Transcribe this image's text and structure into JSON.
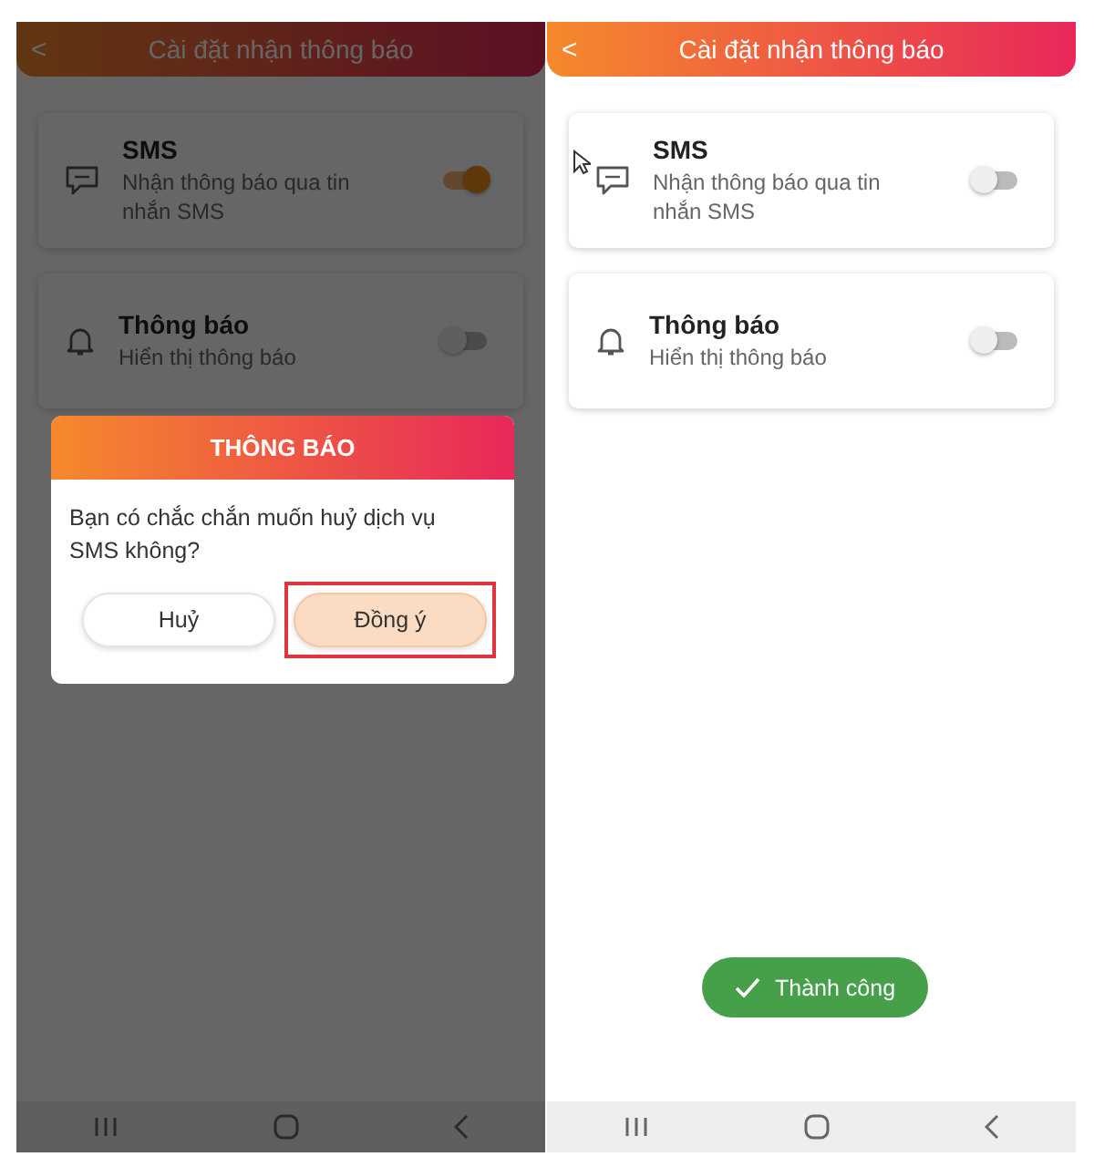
{
  "screens": [
    {
      "header": {
        "back": "<",
        "title": "Cài đặt nhận thông báo"
      },
      "dimmed": true,
      "settings": [
        {
          "title": "SMS",
          "description": "Nhận thông báo qua tin nhắn SMS",
          "on": true
        },
        {
          "title": "Thông báo",
          "description": "Hiển thị thông báo",
          "on": false
        }
      ],
      "dialog": {
        "title": "THÔNG BÁO",
        "message": "Bạn có chắc chắn muốn huỷ dịch vụ SMS không?",
        "buttons": [
          {
            "label": "Huỷ",
            "primary": false,
            "highlighted": false
          },
          {
            "label": "Đồng ý",
            "primary": true,
            "highlighted": true
          }
        ]
      }
    },
    {
      "header": {
        "back": "<",
        "title": "Cài đặt nhận thông báo"
      },
      "dimmed": false,
      "settings": [
        {
          "title": "SMS",
          "description": "Nhận thông báo qua tin nhắn SMS",
          "on": false
        },
        {
          "title": "Thông báo",
          "description": "Hiển thị thông báo",
          "on": false
        }
      ],
      "toast": {
        "text": "Thành công"
      }
    }
  ]
}
